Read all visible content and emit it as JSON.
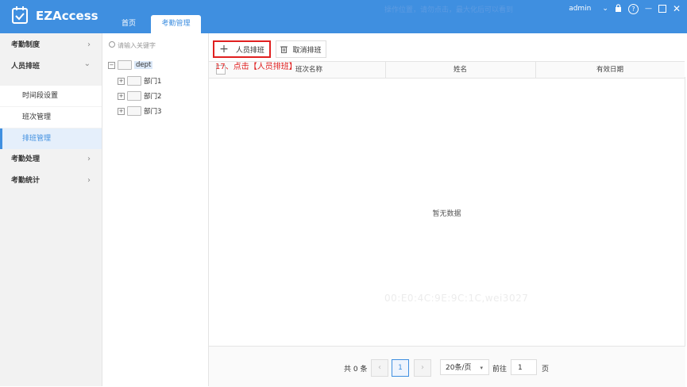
{
  "app": {
    "title": "EZAccess"
  },
  "tabs": [
    {
      "label": "首页"
    },
    {
      "label": "考勤管理"
    }
  ],
  "watermark_top": "操作位置，请勿点击，最大化后可以看到",
  "user": {
    "name": "admin"
  },
  "sidebar": {
    "items": [
      {
        "label": "考勤制度",
        "arrow": "›"
      },
      {
        "label": "人员排班",
        "arrow": "⌄"
      },
      {
        "label": "时间段设置"
      },
      {
        "label": "班次管理"
      },
      {
        "label": "排班管理"
      },
      {
        "label": "考勤处理",
        "arrow": "›"
      },
      {
        "label": "考勤统计",
        "arrow": "›"
      }
    ]
  },
  "tree": {
    "search_placeholder": "请输入关键字",
    "root": "dept",
    "children": [
      "部门1",
      "部门2",
      "部门3"
    ]
  },
  "toolbar": {
    "add_label": "人员排班",
    "cancel_label": "取消排班"
  },
  "annotation": "17、点击【人员排班】",
  "table": {
    "columns": [
      "班次名称",
      "姓名",
      "有效日期"
    ],
    "empty_text": "暂无数据"
  },
  "watermark_mid": "00:E0:4C:9E:9C:1C,wei3027",
  "pagination": {
    "total": "共 0 条",
    "current_page": "1",
    "page_size": "20条/页",
    "goto_label": "前往",
    "goto_value": "1",
    "page_unit": "页"
  },
  "colors": {
    "primary": "#3f8fe0",
    "annotation": "#e02020"
  }
}
